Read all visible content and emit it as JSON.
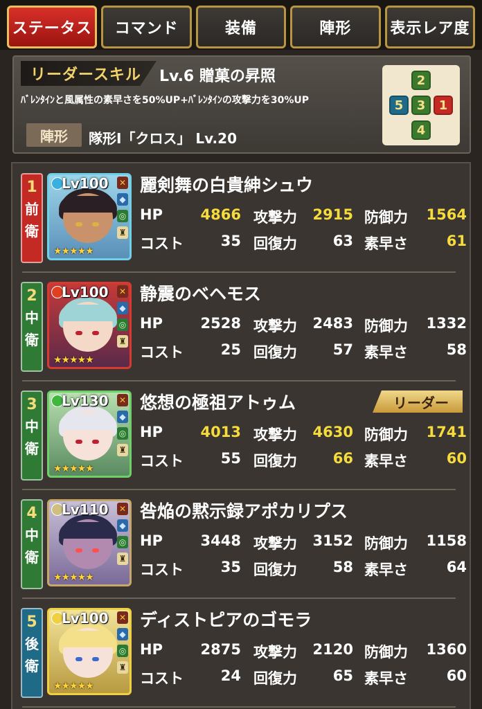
{
  "tabs": [
    {
      "label": "ステータス",
      "active": true
    },
    {
      "label": "コマンド",
      "active": false
    },
    {
      "label": "装備",
      "active": false
    },
    {
      "label": "陣形",
      "active": false
    },
    {
      "label": "表示レア度",
      "active": false
    }
  ],
  "leader_skill": {
    "tag": "リーダースキル",
    "title": "Lv.6 贈菓の昇照",
    "description": "ﾊﾞﾚﾝﾀｲﾝと風属性の素早さを50%UP+ﾊﾞﾚﾝﾀｲﾝの攻撃力を30%UP"
  },
  "formation": {
    "tag": "陣形",
    "text": "隊形Ⅰ「クロス」 Lv.20",
    "slots": [
      "2",
      "5",
      "3",
      "1",
      "4"
    ]
  },
  "stat_labels": {
    "hp": "HP",
    "attack": "攻撃力",
    "defense": "防御力",
    "cost": "コスト",
    "recovery": "回復力",
    "speed": "素早さ"
  },
  "members": [
    {
      "pos_num": "1",
      "pos_1": "前",
      "pos_2": "衛",
      "pos_color": "#c42a24",
      "level": "Lv100",
      "name": "麗剣舞の白貴紳シュウ",
      "hp": "4866",
      "attack": "2915",
      "defense": "1564",
      "cost": "35",
      "recovery": "63",
      "speed": "61",
      "highlight": {
        "hp": true,
        "attack": true,
        "defense": true,
        "speed": true
      },
      "leader": false
    },
    {
      "pos_num": "2",
      "pos_1": "中",
      "pos_2": "衛",
      "pos_color": "#2f7a34",
      "level": "Lv100",
      "name": "静震のベヘモス",
      "hp": "2528",
      "attack": "2483",
      "defense": "1332",
      "cost": "25",
      "recovery": "57",
      "speed": "58",
      "highlight": {},
      "leader": false
    },
    {
      "pos_num": "3",
      "pos_1": "中",
      "pos_2": "衛",
      "pos_color": "#2f7a34",
      "level": "Lv130",
      "name": "悠想の極祖アトゥム",
      "hp": "4013",
      "attack": "4630",
      "defense": "1741",
      "cost": "55",
      "recovery": "66",
      "speed": "60",
      "highlight": {
        "hp": true,
        "attack": true,
        "defense": true,
        "recovery": true,
        "speed": true
      },
      "leader": true,
      "leader_label": "リーダー"
    },
    {
      "pos_num": "4",
      "pos_1": "中",
      "pos_2": "衛",
      "pos_color": "#2f7a34",
      "level": "Lv110",
      "name": "咎焔の黙示録アポカリプス",
      "hp": "3448",
      "attack": "3152",
      "defense": "1158",
      "cost": "35",
      "recovery": "58",
      "speed": "64",
      "highlight": {},
      "leader": false
    },
    {
      "pos_num": "5",
      "pos_1": "後",
      "pos_2": "衛",
      "pos_color": "#1f6a86",
      "level": "Lv100",
      "name": "ディストピアのゴモラ",
      "hp": "2875",
      "attack": "2120",
      "defense": "1360",
      "cost": "24",
      "recovery": "65",
      "speed": "60",
      "highlight": {},
      "leader": false
    }
  ]
}
